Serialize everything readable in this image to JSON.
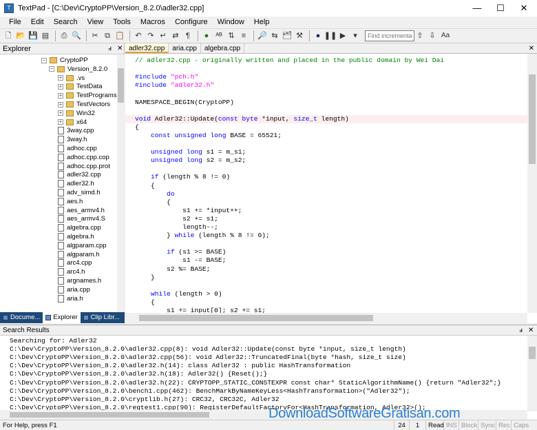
{
  "window": {
    "title": "TextPad - [C:\\Dev\\CryptoPP\\Version_8.2.0\\adler32.cpp]",
    "controls": {
      "minimize": "—",
      "maximize": "☐",
      "close": "✕"
    }
  },
  "menubar": {
    "items": [
      "File",
      "Edit",
      "Search",
      "View",
      "Tools",
      "Macros",
      "Configure",
      "Window",
      "Help"
    ]
  },
  "toolbar": {
    "find_placeholder": "Find incrementally",
    "match_case_label": "Aa"
  },
  "explorer": {
    "title": "Explorer",
    "tree": [
      {
        "label": "CryptoPP",
        "type": "folder",
        "expander": "−",
        "depth": 0
      },
      {
        "label": "Version_8.2.0",
        "type": "folder",
        "expander": "−",
        "depth": 1
      },
      {
        "label": ".vs",
        "type": "folder",
        "expander": "+",
        "depth": 2
      },
      {
        "label": "TestData",
        "type": "folder",
        "expander": "+",
        "depth": 2
      },
      {
        "label": "TestPrograms",
        "type": "folder",
        "expander": "+",
        "depth": 2
      },
      {
        "label": "TestVectors",
        "type": "folder",
        "expander": "+",
        "depth": 2
      },
      {
        "label": "Win32",
        "type": "folder",
        "expander": "+",
        "depth": 2
      },
      {
        "label": "x64",
        "type": "folder",
        "expander": "+",
        "depth": 2
      },
      {
        "label": "3way.cpp",
        "type": "file",
        "depth": 2
      },
      {
        "label": "3way.h",
        "type": "file",
        "depth": 2
      },
      {
        "label": "adhoc.cpp",
        "type": "file",
        "depth": 2
      },
      {
        "label": "adhoc.cpp.cop",
        "type": "file",
        "depth": 2
      },
      {
        "label": "adhoc.cpp.prot",
        "type": "file",
        "depth": 2
      },
      {
        "label": "adler32.cpp",
        "type": "file",
        "depth": 2
      },
      {
        "label": "adler32.h",
        "type": "file",
        "depth": 2
      },
      {
        "label": "adv_simd.h",
        "type": "file",
        "depth": 2
      },
      {
        "label": "aes.h",
        "type": "file",
        "depth": 2
      },
      {
        "label": "aes_armv4.h",
        "type": "file",
        "depth": 2
      },
      {
        "label": "aes_armv4.S",
        "type": "file",
        "depth": 2
      },
      {
        "label": "algebra.cpp",
        "type": "file",
        "depth": 2
      },
      {
        "label": "algebra.h",
        "type": "file",
        "depth": 2
      },
      {
        "label": "algparam.cpp",
        "type": "file",
        "depth": 2
      },
      {
        "label": "algparam.h",
        "type": "file",
        "depth": 2
      },
      {
        "label": "arc4.cpp",
        "type": "file",
        "depth": 2
      },
      {
        "label": "arc4.h",
        "type": "file",
        "depth": 2
      },
      {
        "label": "argnames.h",
        "type": "file",
        "depth": 2
      },
      {
        "label": "aria.cpp",
        "type": "file",
        "depth": 2
      },
      {
        "label": "aria.h",
        "type": "file",
        "depth": 2
      }
    ],
    "tabs": [
      "Docume...",
      "Explorer",
      "Clip Libr..."
    ],
    "active_tab": "Explorer"
  },
  "editor": {
    "tabs": [
      "adler32.cpp",
      "aria.cpp",
      "algebra.cpp"
    ],
    "active_tab": "adler32.cpp",
    "highlight_line": 7,
    "lines": [
      "// adler32.cpp - originally written and placed in the public domain by Wei Dai",
      "",
      "#include \"pch.h\"",
      "#include \"adler32.h\"",
      "",
      "NAMESPACE_BEGIN(CryptoPP)",
      "",
      "void Adler32::Update(const byte *input, size_t length)",
      "{",
      "    const unsigned long BASE = 65521;",
      "",
      "    unsigned long s1 = m_s1;",
      "    unsigned long s2 = m_s2;",
      "",
      "    if (length % 8 != 0)",
      "    {",
      "        do",
      "        {",
      "            s1 += *input++;",
      "            s2 += s1;",
      "            length--;",
      "        } while (length % 8 != 0);",
      "",
      "        if (s1 >= BASE)",
      "            s1 -= BASE;",
      "        s2 %= BASE;",
      "    }",
      "",
      "    while (length > 0)",
      "    {",
      "        s1 += input[0]; s2 += s1;"
    ]
  },
  "search_results": {
    "title": "Search Results",
    "lines": [
      "Searching for: Adler32",
      "C:\\Dev\\CryptoPP\\Version_8.2.0\\adler32.cpp(8): void Adler32::Update(const byte *input, size_t length)",
      "C:\\Dev\\CryptoPP\\Version_8.2.0\\adler32.cpp(56): void Adler32::TruncatedFinal(byte *hash, size_t size)",
      "C:\\Dev\\CryptoPP\\Version_8.2.0\\adler32.h(14): class Adler32 : public HashTransformation",
      "C:\\Dev\\CryptoPP\\Version_8.2.0\\adler32.h(18): Adler32() {Reset();}",
      "C:\\Dev\\CryptoPP\\Version_8.2.0\\adler32.h(22): CRYPTOPP_STATIC_CONSTEXPR const char* StaticAlgorithmName() {return \"Adler32\";}",
      "C:\\Dev\\CryptoPP\\Version_8.2.0\\bench1.cpp(462): BenchMarkByNameKeyLess<HashTransformation>(\"Adler32\");",
      "C:\\Dev\\CryptoPP\\Version_8.2.0\\cryptlib.h(27): CRC32, CRC32C, Adler32",
      "C:\\Dev\\CryptoPP\\Version_8.2.0\\regtest1.cpp(90): RegisterDefaultFactoryFor<HashTransformation, Adler32>();"
    ]
  },
  "statusbar": {
    "message": "For Help, press F1",
    "line": "24",
    "column": "1",
    "mode": "Read",
    "ins": "INS",
    "block": "Block",
    "sync": "Sync",
    "rec": "Rec",
    "caps": "Caps"
  },
  "watermark": "DownloadSoftwareGratisan.com",
  "colors": {
    "keyword": "#0000ff",
    "comment": "#008000",
    "string": "#ff00ff",
    "highlight_line_bg": "#fdeeee",
    "explorer_tabs_bg": "#1e4a7a",
    "watermark": "#2a7fd4"
  }
}
